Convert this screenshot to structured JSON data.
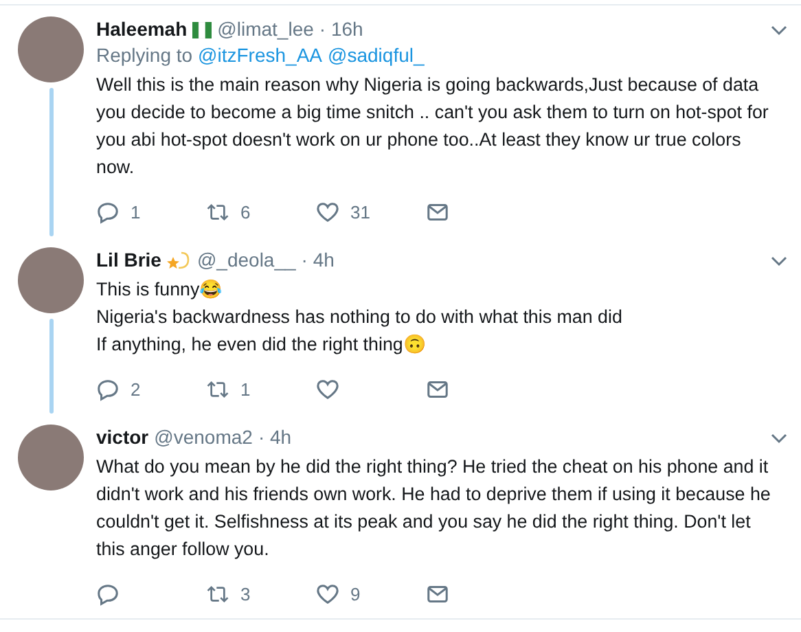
{
  "tweets": [
    {
      "name": "Haleemah",
      "badge": {
        "kind": "flag"
      },
      "handle": "@limat_lee",
      "time": "· 16h",
      "thread": true,
      "replying_label": "Replying to",
      "replying_to": [
        "@itzFresh_AA",
        "@sadiqful_"
      ],
      "text": "Well this is the main reason why Nigeria is going backwards,Just because of data you decide to become a big time snitch .. can't you ask them to turn on hot-spot for you abi hot-spot doesn't work on ur phone too..At least they  know ur true colors now.",
      "replies": "1",
      "retweets": "6",
      "likes": "31"
    },
    {
      "name": "Lil Brie",
      "badge": {
        "kind": "sparkle"
      },
      "handle": "@_deola__",
      "time": "· 4h",
      "thread": true,
      "text": "This is funny😂\nNigeria's backwardness has nothing to do with what this man did\nIf anything, he even did the right thing🙃",
      "replies": "2",
      "retweets": "1"
    },
    {
      "name": "victor",
      "handle": "@venoma2",
      "time": "· 4h",
      "thread": false,
      "text": "What do you mean by he did the right thing? He tried the cheat on his phone and it didn't work and his friends own work. He had to deprive them if using it because he couldn't get it. Selfishness at its peak and you say he did the right thing. Don't let this anger follow you.",
      "retweets": "3",
      "likes": "9"
    }
  ]
}
